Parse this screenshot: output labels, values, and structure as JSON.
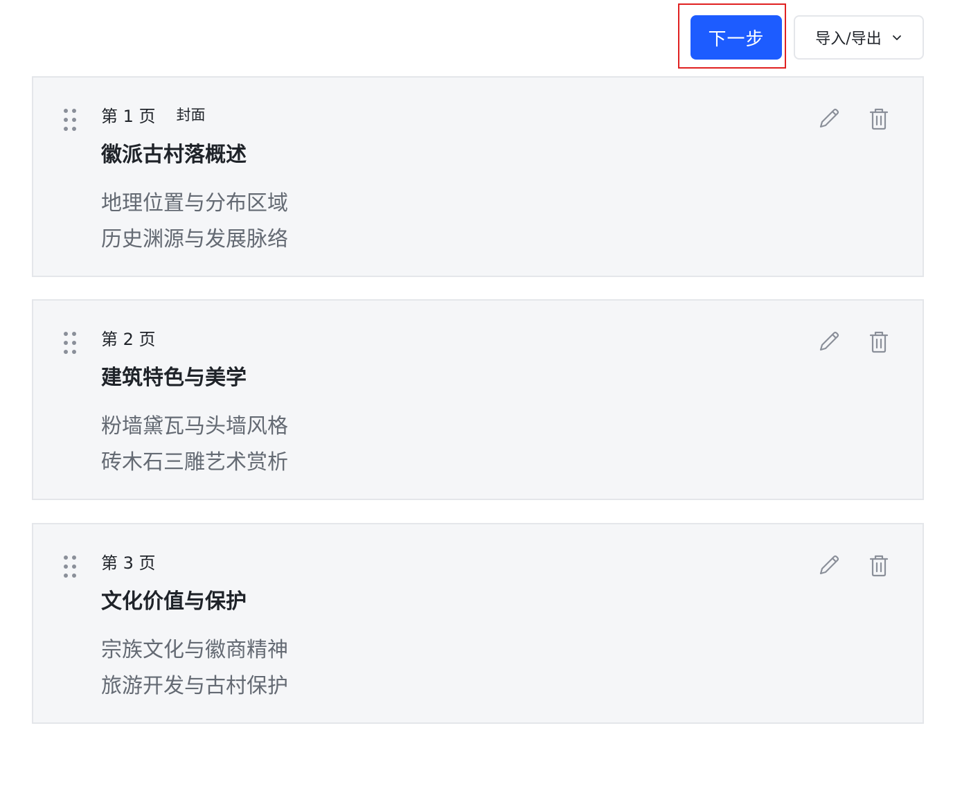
{
  "toolbar": {
    "next_label": "下一步",
    "export_label": "导入/导出"
  },
  "icons": {
    "drag": "drag-dots-icon",
    "edit": "pencil-icon",
    "delete": "trash-icon",
    "dropdown": "chevron-down-icon"
  },
  "colors": {
    "primary": "#1d5cff",
    "highlight": "#e02020",
    "card_bg": "#f5f6f8",
    "icon": "#8a8f99"
  },
  "pages": [
    {
      "number": "第 1 页",
      "tag": "封面",
      "title": "徽派古村落概述",
      "points": [
        "地理位置与分布区域",
        "历史渊源与发展脉络"
      ]
    },
    {
      "number": "第 2 页",
      "tag": "",
      "title": "建筑特色与美学",
      "points": [
        "粉墙黛瓦马头墙风格",
        "砖木石三雕艺术赏析"
      ]
    },
    {
      "number": "第 3 页",
      "tag": "",
      "title": "文化价值与保护",
      "points": [
        "宗族文化与徽商精神",
        "旅游开发与古村保护"
      ]
    }
  ]
}
